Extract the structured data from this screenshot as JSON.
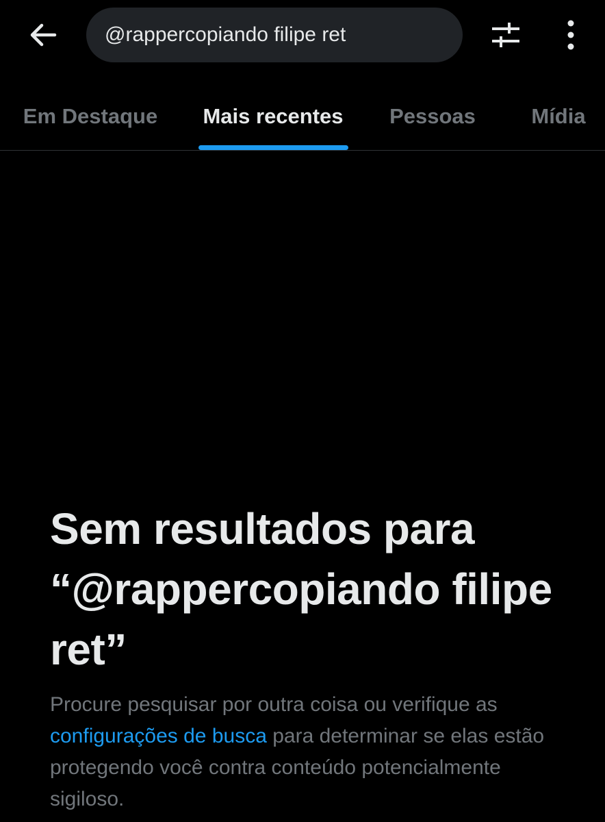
{
  "search": {
    "query": "@rappercopiando filipe ret"
  },
  "icons": {
    "back": "back-arrow-icon",
    "filter": "sliders-icon",
    "more": "more-vertical-icon"
  },
  "tabs": [
    {
      "label": "Em Destaque",
      "active": false
    },
    {
      "label": "Mais recentes",
      "active": true
    },
    {
      "label": "Pessoas",
      "active": false
    },
    {
      "label": "Mídia",
      "active": false
    }
  ],
  "empty_state": {
    "title": "Sem resultados para “@rappercopiando filipe ret”",
    "desc_before": "Procure pesquisar por outra coisa ou verifique as ",
    "desc_link": "configurações de busca",
    "desc_after": " para determinar se elas estão protegendo você contra conteúdo potencialmente sigiloso."
  },
  "colors": {
    "background": "#000000",
    "search_field": "#202327",
    "primary_text": "#e7e9ea",
    "secondary_text": "#71767b",
    "accent": "#1d9bf0",
    "divider": "#2f3336"
  }
}
